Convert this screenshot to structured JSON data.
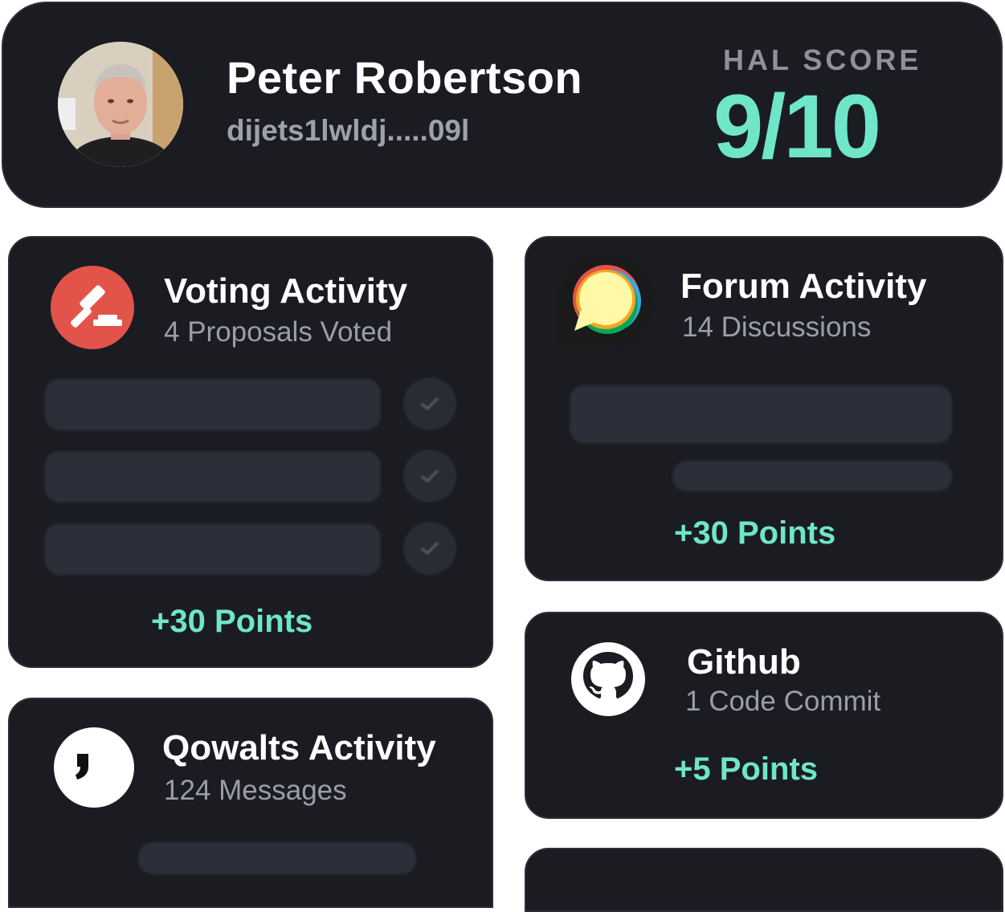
{
  "profile": {
    "name": "Peter Robertson",
    "wallet": "dijets1lwldj.....09l",
    "hal_score_label": "HAL SCORE",
    "hal_score_value": "9/10"
  },
  "voting": {
    "title": "Voting Activity",
    "subtitle": "4 Proposals Voted",
    "points": "+30 Points",
    "icon": "gavel-icon"
  },
  "forum": {
    "title": "Forum Activity",
    "subtitle": "14 Discussions",
    "points": "+30 Points",
    "icon": "discourse-chat-icon"
  },
  "github": {
    "title": "Github",
    "subtitle": "1 Code Commit",
    "points": "+5 Points",
    "icon": "github-icon"
  },
  "qowalts": {
    "title": "Qowalts Activity",
    "subtitle": "124 Messages",
    "icon": "quote-comma-icon"
  },
  "colors": {
    "card_bg": "#1b1c22",
    "accent": "#6fe6c9",
    "gavel_red": "#e2544a"
  }
}
